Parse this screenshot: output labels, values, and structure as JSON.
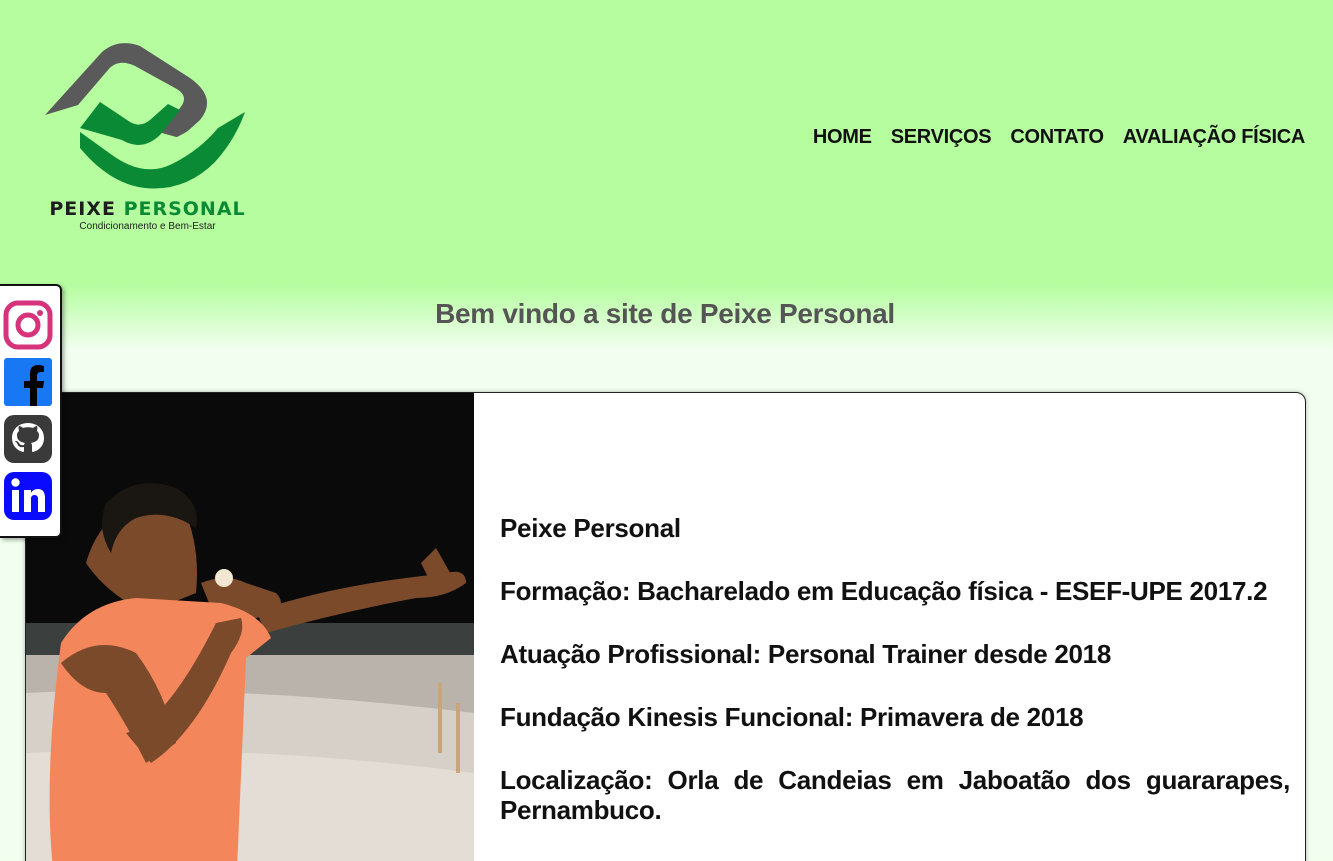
{
  "brand": {
    "name_part1": "PEIXE",
    "name_part2": "PERSONAL",
    "tagline": "Condicionamento e Bem-Estar",
    "colors": {
      "green": "#0b8a35",
      "gray": "#555555",
      "header_bg": "#b5fd9f"
    }
  },
  "nav": {
    "items": [
      {
        "label": "HOME"
      },
      {
        "label": "SERVIÇOS"
      },
      {
        "label": "CONTATO"
      },
      {
        "label": "AVALIAÇÃO FÍSICA"
      }
    ]
  },
  "welcome": "Bem vindo a site de Peixe Personal",
  "social": {
    "icons": [
      "instagram-icon",
      "facebook-icon",
      "github-icon",
      "linkedin-icon"
    ]
  },
  "profile": {
    "name": "Peixe Personal",
    "formacao": "Formação: Bacharelado em Educação física - ESEF-UPE 2017.2",
    "atuacao": "Atuação Profissional: Personal Trainer desde 2018",
    "fundacao": "Fundação Kinesis Funcional: Primavera de 2018",
    "localizacao": "Localização: Orla de Candeias em Jaboatão dos guararapes, Pernambuco."
  }
}
